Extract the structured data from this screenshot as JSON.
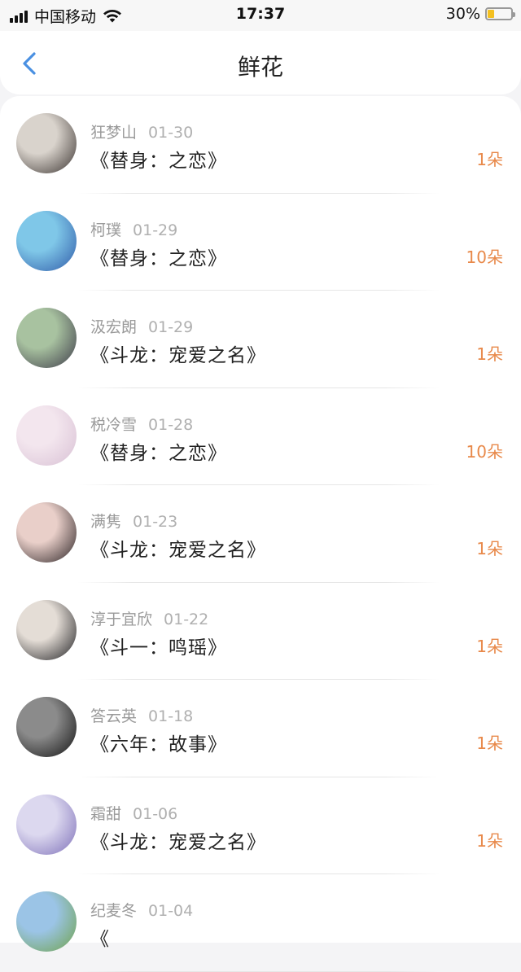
{
  "status_bar": {
    "carrier": "中国移动",
    "time": "17:37",
    "battery_pct": "30%",
    "battery_level": 0.3,
    "battery_color": "#f4c020"
  },
  "header": {
    "title": "鲜花",
    "back_icon": "chevron-left-icon",
    "accent": "#4a90e2"
  },
  "list": {
    "amount_color": "#e8894a",
    "items": [
      {
        "user": "狂梦山",
        "date": "01-30",
        "book": "《替身：之恋》",
        "amount": "1朵",
        "avatar_colors": [
          "#d9d3cc",
          "#3a3330"
        ]
      },
      {
        "user": "柯璞",
        "date": "01-29",
        "book": "《替身：之恋》",
        "amount": "10朵",
        "avatar_colors": [
          "#7fc7e8",
          "#2f5aa8"
        ]
      },
      {
        "user": "汲宏朗",
        "date": "01-29",
        "book": "《斗龙：宠爱之名》",
        "amount": "1朵",
        "avatar_colors": [
          "#a8c2a0",
          "#3c3a48"
        ]
      },
      {
        "user": "税冷雪",
        "date": "01-28",
        "book": "《替身：之恋》",
        "amount": "10朵",
        "avatar_colors": [
          "#f3e6ee",
          "#d8c0d4"
        ]
      },
      {
        "user": "满隽",
        "date": "01-23",
        "book": "《斗龙：宠爱之名》",
        "amount": "1朵",
        "avatar_colors": [
          "#e9cfc9",
          "#2a2224"
        ]
      },
      {
        "user": "淳于宜欣",
        "date": "01-22",
        "book": "《斗一：鸣瑶》",
        "amount": "1朵",
        "avatar_colors": [
          "#e4ddd6",
          "#1f1f22"
        ]
      },
      {
        "user": "答云英",
        "date": "01-18",
        "book": "《六年：故事》",
        "amount": "1朵",
        "avatar_colors": [
          "#8b8b8b",
          "#121212"
        ]
      },
      {
        "user": "霜甜",
        "date": "01-06",
        "book": "《斗龙：宠爱之名》",
        "amount": "1朵",
        "avatar_colors": [
          "#dcd8ef",
          "#7d6fb8"
        ]
      },
      {
        "user": "纪麦冬",
        "date": "01-04",
        "book": "《",
        "amount": "",
        "avatar_colors": [
          "#9bc4e6",
          "#6fa24a"
        ]
      }
    ]
  }
}
